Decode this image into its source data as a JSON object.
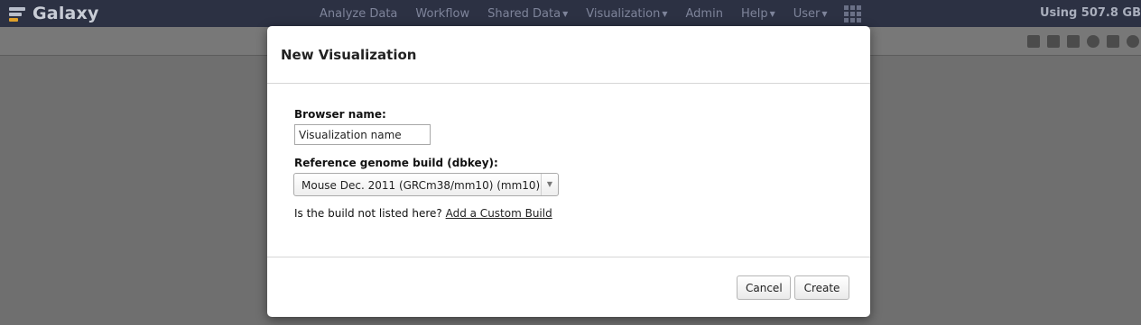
{
  "masthead": {
    "brand": "Galaxy",
    "nav": [
      {
        "label": "Analyze Data",
        "dropdown": false
      },
      {
        "label": "Workflow",
        "dropdown": false
      },
      {
        "label": "Shared Data",
        "dropdown": true
      },
      {
        "label": "Visualization",
        "dropdown": true
      },
      {
        "label": "Admin",
        "dropdown": false
      },
      {
        "label": "Help",
        "dropdown": true
      },
      {
        "label": "User",
        "dropdown": true
      }
    ],
    "quota": "Using 507.8 GB",
    "colors": {
      "background": "#2c3143",
      "brand_accent": "#e0a12a"
    }
  },
  "toolbar_icons": [
    "add-icon",
    "copy-icon",
    "tag-icon",
    "globe-icon",
    "save-icon",
    "close-circle-icon"
  ],
  "modal": {
    "title": "New Visualization",
    "browser_name_label": "Browser name:",
    "browser_name_value": "Visualization name",
    "dbkey_label": "Reference genome build (dbkey):",
    "dbkey_selected": "Mouse Dec. 2011 (GRCm38/mm10) (mm10)",
    "help_text": "Is the build not listed here?",
    "custom_build_link": "Add a Custom Build",
    "cancel_label": "Cancel",
    "create_label": "Create"
  }
}
